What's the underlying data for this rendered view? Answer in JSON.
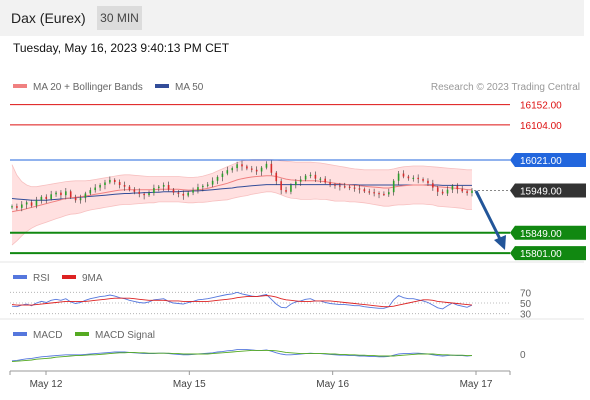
{
  "header": {
    "instrument": "Dax (Eurex)",
    "timeframe": "30 MIN"
  },
  "timestamp": "Tuesday, May 16, 2023 9:40:13 PM CET",
  "colors": {
    "resistance": "#dd1111",
    "pivot": "#2266dd",
    "support": "#118811",
    "last": "#333333",
    "ma20": "#f08080",
    "ma50": "#334d99",
    "band": "#ffe0e0",
    "rsi": "#5577dd",
    "rsi_ma": "#dd2222",
    "macd": "#5577dd",
    "macd_signal": "#55aa22",
    "arrow": "#225599",
    "candle_up": "#2a9d2a",
    "candle_down": "#d62b2b"
  },
  "chart_data": [
    {
      "type": "line",
      "panel": "price",
      "legend": [
        {
          "name": "MA 20 + Bollinger Bands",
          "color": "#f08080"
        },
        {
          "name": "MA 50",
          "color": "#334d99"
        }
      ],
      "credit": "Research © 2023 Trading Central",
      "ylim": [
        15780,
        16170
      ],
      "x_labels": [
        "May 12",
        "May 15",
        "May 16",
        "May 17"
      ],
      "levels": [
        {
          "value": 16152.0,
          "label": "16152.00",
          "kind": "resistance"
        },
        {
          "value": 16104.0,
          "label": "16104.00",
          "kind": "resistance"
        },
        {
          "value": 16021.0,
          "label": "16021.00",
          "kind": "pivot"
        },
        {
          "value": 15949.0,
          "label": "15949.00",
          "kind": "last"
        },
        {
          "value": 15849.0,
          "label": "15849.00",
          "kind": "support"
        },
        {
          "value": 15801.0,
          "label": "15801.00",
          "kind": "support"
        }
      ],
      "close": [
        15912,
        15908,
        15916,
        15921,
        15913,
        15926,
        15934,
        15929,
        15940,
        15944,
        15938,
        15947,
        15933,
        15926,
        15931,
        15942,
        15950,
        15956,
        15962,
        15968,
        15974,
        15969,
        15962,
        15958,
        15951,
        15946,
        15941,
        15938,
        15943,
        15955,
        15958,
        15962,
        15951,
        15944,
        15941,
        15937,
        15944,
        15950,
        15957,
        15960,
        15963,
        15972,
        15981,
        15989,
        15997,
        16002,
        16011,
        16006,
        16001,
        15998,
        15994,
        16003,
        16012,
        15991,
        15971,
        15950,
        15946,
        15962,
        15970,
        15975,
        15984,
        15986,
        15977,
        15977,
        15968,
        15963,
        15961,
        15959,
        15958,
        15956,
        15954,
        15952,
        15947,
        15945,
        15943,
        15941,
        15940,
        15945,
        15972,
        15989,
        15982,
        15978,
        15979,
        15976,
        15972,
        15966,
        15956,
        15946,
        15942,
        15951,
        15960,
        15952,
        15947,
        15943,
        15949
      ],
      "ma20": [
        15899,
        15901,
        15903,
        15906,
        15909,
        15912,
        15915,
        15918,
        15921,
        15924,
        15927,
        15930,
        15932,
        15933,
        15934,
        15936,
        15938,
        15940,
        15942,
        15944,
        15946,
        15948,
        15950,
        15951,
        15951,
        15951,
        15951,
        15951,
        15951,
        15951,
        15952,
        15952,
        15952,
        15952,
        15952,
        15951,
        15950,
        15950,
        15951,
        15952,
        15954,
        15957,
        15960,
        15963,
        15966,
        15970,
        15974,
        15977,
        15979,
        15981,
        15982,
        15983,
        15984,
        15984,
        15982,
        15979,
        15976,
        15974,
        15973,
        15972,
        15972,
        15972,
        15972,
        15971,
        15970,
        15968,
        15966,
        15965,
        15964,
        15962,
        15961,
        15960,
        15959,
        15958,
        15957,
        15956,
        15955,
        15955,
        15957,
        15959,
        15960,
        15961,
        15962,
        15962,
        15962,
        15961,
        15960,
        15958,
        15957,
        15956,
        15955,
        15954,
        15953,
        15951,
        15951
      ],
      "ma50": [
        15930,
        15929,
        15928,
        15927,
        15926,
        15926,
        15926,
        15926,
        15927,
        15928,
        15929,
        15930,
        15931,
        15932,
        15933,
        15934,
        15935,
        15936,
        15937,
        15938,
        15939,
        15940,
        15941,
        15942,
        15942,
        15943,
        15943,
        15944,
        15944,
        15945,
        15945,
        15946,
        15946,
        15946,
        15946,
        15947,
        15947,
        15948,
        15948,
        15949,
        15950,
        15951,
        15952,
        15953,
        15954,
        15955,
        15957,
        15958,
        15959,
        15960,
        15961,
        15962,
        15963,
        15963,
        15963,
        15963,
        15963,
        15963,
        15963,
        15963,
        15963,
        15963,
        15963,
        15963,
        15963,
        15963,
        15963,
        15963,
        15963,
        15963,
        15963,
        15962,
        15962,
        15962,
        15962,
        15962,
        15962,
        15962,
        15962,
        15962,
        15962,
        15962,
        15962,
        15962,
        15962,
        15962,
        15962,
        15962,
        15961,
        15961,
        15961,
        15961,
        15961,
        15961,
        15961
      ],
      "bb_upper": [
        16010,
        15985,
        15970,
        15962,
        15958,
        15958,
        15960,
        15962,
        15964,
        15966,
        15968,
        15970,
        15971,
        15972,
        15972,
        15972,
        15973,
        15975,
        15977,
        15979,
        15981,
        15983,
        15985,
        15986,
        15986,
        15985,
        15984,
        15983,
        15982,
        15982,
        15982,
        15982,
        15982,
        15982,
        15982,
        15981,
        15980,
        15980,
        15981,
        15983,
        15986,
        15990,
        15995,
        16000,
        16005,
        16010,
        16015,
        16019,
        16021,
        16022,
        16022,
        16022,
        16022,
        16022,
        16021,
        16019,
        16018,
        16017,
        16016,
        16016,
        16016,
        16016,
        16015,
        16014,
        16012,
        16010,
        16008,
        16006,
        16004,
        16002,
        16000,
        15999,
        15998,
        15998,
        15998,
        15998,
        15998,
        15998,
        16000,
        16003,
        16005,
        16006,
        16007,
        16007,
        16007,
        16006,
        16005,
        16004,
        16003,
        16002,
        16001,
        16000,
        15999,
        15998,
        15998
      ],
      "bb_lower": [
        15820,
        15830,
        15842,
        15852,
        15860,
        15866,
        15870,
        15874,
        15878,
        15882,
        15886,
        15890,
        15893,
        15894,
        15896,
        15900,
        15903,
        15905,
        15907,
        15909,
        15911,
        15913,
        15915,
        15916,
        15916,
        15917,
        15918,
        15919,
        15920,
        15920,
        15922,
        15922,
        15922,
        15922,
        15922,
        15921,
        15920,
        15920,
        15921,
        15921,
        15922,
        15924,
        15925,
        15926,
        15927,
        15930,
        15933,
        15935,
        15937,
        15940,
        15942,
        15944,
        15946,
        15946,
        15943,
        15939,
        15934,
        15931,
        15930,
        15928,
        15928,
        15928,
        15929,
        15928,
        15928,
        15926,
        15924,
        15924,
        15924,
        15922,
        15922,
        15921,
        15920,
        15918,
        15916,
        15914,
        15912,
        15912,
        15914,
        15915,
        15915,
        15916,
        15917,
        15917,
        15917,
        15916,
        15915,
        15912,
        15911,
        15910,
        15909,
        15908,
        15907,
        15904,
        15904
      ]
    },
    {
      "type": "line",
      "panel": "rsi",
      "series": [
        {
          "name": "RSI"
        },
        {
          "name": "9MA"
        }
      ],
      "levels": [
        70,
        50,
        30
      ],
      "ylim": [
        20,
        80
      ],
      "rsi": [
        44,
        43,
        46,
        48,
        45,
        50,
        53,
        51,
        55,
        57,
        55,
        58,
        52,
        49,
        51,
        55,
        58,
        60,
        62,
        63,
        65,
        63,
        60,
        58,
        55,
        53,
        51,
        50,
        52,
        56,
        57,
        58,
        53,
        50,
        49,
        48,
        51,
        53,
        56,
        57,
        58,
        60,
        62,
        64,
        66,
        67,
        70,
        67,
        65,
        63,
        62,
        64,
        66,
        57,
        48,
        42,
        41,
        48,
        52,
        54,
        57,
        58,
        54,
        54,
        51,
        49,
        48,
        47,
        47,
        46,
        45,
        45,
        43,
        42,
        41,
        40,
        40,
        43,
        56,
        64,
        60,
        58,
        58,
        56,
        54,
        51,
        46,
        41,
        39,
        45,
        50,
        46,
        44,
        42,
        46
      ],
      "rsi_ma": [
        47,
        46,
        46,
        46,
        46,
        47,
        48,
        49,
        50,
        51,
        52,
        53,
        53,
        53,
        53,
        53,
        54,
        55,
        56,
        57,
        58,
        59,
        59,
        59,
        59,
        58,
        57,
        56,
        55,
        55,
        55,
        55,
        54,
        54,
        54,
        53,
        53,
        53,
        53,
        53,
        53,
        54,
        55,
        56,
        57,
        58,
        60,
        61,
        62,
        62,
        62,
        63,
        64,
        63,
        61,
        58,
        56,
        55,
        54,
        53,
        53,
        53,
        54,
        54,
        54,
        54,
        53,
        52,
        51,
        50,
        49,
        48,
        47,
        46,
        45,
        44,
        43,
        43,
        44,
        46,
        48,
        50,
        52,
        54,
        56,
        56,
        55,
        53,
        52,
        51,
        50,
        49,
        48,
        47,
        46
      ]
    },
    {
      "type": "line",
      "panel": "macd",
      "series": [
        {
          "name": "MACD"
        },
        {
          "name": "MACD Signal"
        }
      ],
      "levels": [
        0
      ],
      "ylim": [
        -25,
        25
      ],
      "macd": [
        -17,
        -16,
        -14,
        -12,
        -11,
        -9,
        -7,
        -6,
        -5,
        -4,
        -3,
        -2,
        -2,
        -2,
        -2,
        -1,
        0,
        1,
        2,
        3,
        4,
        5,
        5,
        5,
        4,
        3,
        2,
        1,
        1,
        1,
        2,
        2,
        1,
        0,
        -1,
        -2,
        -2,
        -1,
        0,
        1,
        2,
        3,
        5,
        6,
        8,
        9,
        11,
        11,
        11,
        10,
        9,
        9,
        10,
        7,
        3,
        0,
        -2,
        -2,
        -1,
        0,
        1,
        2,
        1,
        1,
        0,
        -1,
        -2,
        -3,
        -3,
        -4,
        -4,
        -5,
        -5,
        -6,
        -6,
        -7,
        -7,
        -6,
        -3,
        0,
        1,
        1,
        2,
        2,
        1,
        0,
        -2,
        -4,
        -5,
        -4,
        -3,
        -4,
        -4,
        -5,
        -4
      ],
      "macd_signal": [
        -19,
        -18,
        -17,
        -16,
        -15,
        -13,
        -12,
        -11,
        -10,
        -8,
        -7,
        -6,
        -5,
        -4,
        -4,
        -3,
        -2,
        -2,
        -1,
        0,
        1,
        2,
        3,
        3,
        4,
        4,
        3,
        3,
        2,
        2,
        2,
        2,
        2,
        1,
        1,
        0,
        0,
        0,
        0,
        0,
        0,
        1,
        2,
        3,
        4,
        5,
        6,
        7,
        8,
        9,
        9,
        9,
        9,
        9,
        8,
        6,
        4,
        3,
        2,
        1,
        1,
        1,
        1,
        1,
        1,
        0,
        0,
        -1,
        -1,
        -2,
        -2,
        -3,
        -3,
        -4,
        -4,
        -5,
        -5,
        -5,
        -5,
        -4,
        -3,
        -2,
        -1,
        0,
        0,
        0,
        0,
        -1,
        -2,
        -2,
        -3,
        -3,
        -3,
        -4,
        -4
      ]
    }
  ]
}
